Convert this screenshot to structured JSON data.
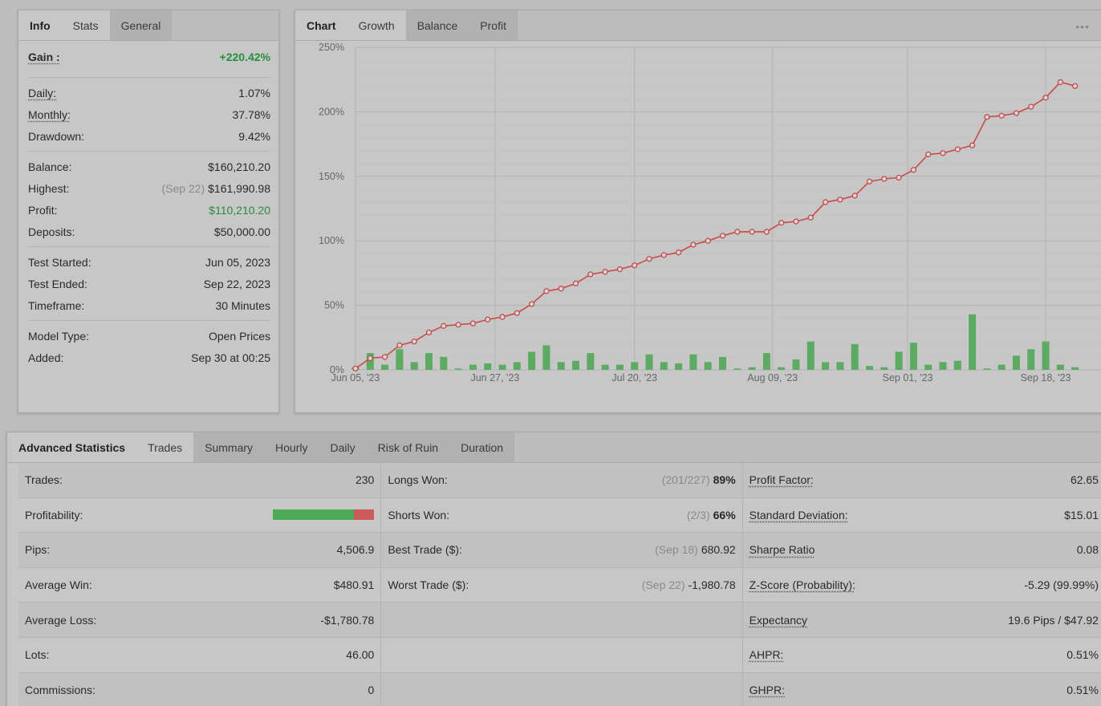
{
  "info_panel": {
    "tabs": [
      "Info",
      "Stats",
      "General"
    ],
    "gain": {
      "label": "Gain :",
      "value": "+220.42%"
    },
    "group1": [
      {
        "label": "Daily:",
        "value": "1.07%"
      },
      {
        "label": "Monthly:",
        "value": "37.78%"
      },
      {
        "label": "Drawdown:",
        "value": "9.42%"
      }
    ],
    "group2": [
      {
        "label": "Balance:",
        "value": "$160,210.20"
      },
      {
        "label": "Highest:",
        "note": "(Sep 22)",
        "value": "$161,990.98"
      },
      {
        "label": "Profit:",
        "value": "$110,210.20"
      },
      {
        "label": "Deposits:",
        "value": "$50,000.00"
      }
    ],
    "group3": [
      {
        "label": "Test Started:",
        "value": "Jun 05, 2023"
      },
      {
        "label": "Test Ended:",
        "value": "Sep 22, 2023"
      },
      {
        "label": "Timeframe:",
        "value": "30 Minutes"
      }
    ],
    "group4": [
      {
        "label": "Model Type:",
        "value": "Open Prices"
      },
      {
        "label": "Added:",
        "value": "Sep 30 at 00:25"
      }
    ],
    "colors": {
      "positive": "#23913a"
    }
  },
  "chart_panel": {
    "tabs": [
      "Chart",
      "Growth",
      "Balance",
      "Profit"
    ],
    "menu_icon": "more-dots-icon"
  },
  "chart_data": {
    "type": "line",
    "title": "",
    "xlabel": "",
    "ylabel": "",
    "ylim": [
      0,
      250
    ],
    "y_ticks": [
      "0%",
      "50%",
      "100%",
      "150%",
      "200%",
      "250%"
    ],
    "x_ticks": [
      "Jun 05, '23",
      "Jun 27, '23",
      "Jul 20, '23",
      "Aug 09, '23",
      "Sep 01, '23",
      "Sep 18, '23"
    ],
    "grid": true,
    "series": [
      {
        "type": "line",
        "color": "#c84a4a",
        "values": [
          1,
          9,
          10,
          19,
          22,
          29,
          34,
          35,
          36,
          39,
          41,
          44,
          51,
          61,
          63,
          67,
          74,
          76,
          78,
          81,
          86,
          89,
          91,
          97,
          100,
          104,
          107,
          107,
          107,
          114,
          115,
          118,
          130,
          132,
          135,
          146,
          148,
          149,
          155,
          167,
          168,
          171,
          174,
          196,
          197,
          199,
          204,
          211,
          223,
          220
        ]
      },
      {
        "type": "bar",
        "color": "#5daa62",
        "values": [
          2,
          13,
          4,
          16,
          6,
          13,
          10,
          1,
          4,
          5,
          4,
          6,
          14,
          19,
          6,
          7,
          13,
          4,
          4,
          6,
          12,
          6,
          5,
          12,
          6,
          10,
          1,
          2,
          13,
          2,
          8,
          22,
          6,
          6,
          20,
          3,
          2,
          14,
          21,
          4,
          6,
          7,
          43,
          1,
          4,
          11,
          16,
          22,
          4,
          2
        ]
      }
    ]
  },
  "advanced": {
    "tabs": [
      "Advanced Statistics",
      "Trades",
      "Summary",
      "Hourly",
      "Daily",
      "Risk of Ruin",
      "Duration"
    ],
    "col1": [
      {
        "label": "Trades:",
        "value": "230"
      },
      {
        "label": "Profitability:",
        "value": "",
        "bar": {
          "win_fraction": 0.8
        }
      },
      {
        "label": "Pips:",
        "value": "4,506.9"
      },
      {
        "label": "Average Win:",
        "value": "$480.91"
      },
      {
        "label": "Average Loss:",
        "value": "-$1,780.78"
      },
      {
        "label": "Lots:",
        "value": "46.00"
      },
      {
        "label": "Commissions:",
        "value": "0"
      }
    ],
    "col2": [
      {
        "label": "Longs Won:",
        "note": "(201/227)",
        "value": "89%"
      },
      {
        "label": "Shorts Won:",
        "note": "(2/3)",
        "value": "66%"
      },
      {
        "label": "Best Trade ($):",
        "note": "(Sep 18)",
        "value": "680.92"
      },
      {
        "label": "Worst Trade ($):",
        "note": "(Sep 22)",
        "value": "-1,980.78"
      },
      {
        "label": "",
        "note": "",
        "value": ""
      },
      {
        "label": "",
        "note": "",
        "value": ""
      },
      {
        "label": "",
        "note": "",
        "value": ""
      }
    ],
    "col3": [
      {
        "label": "Profit Factor:",
        "value": "62.65"
      },
      {
        "label": "Standard Deviation:",
        "value": "$15.01"
      },
      {
        "label": "Sharpe Ratio",
        "value": "0.08"
      },
      {
        "label": "Z-Score (Probability):",
        "value": "-5.29 (99.99%)"
      },
      {
        "label": "Expectancy",
        "value": "19.6 Pips / $47.92"
      },
      {
        "label": "AHPR:",
        "value": "0.51%"
      },
      {
        "label": "GHPR:",
        "value": "0.51%"
      }
    ],
    "colors": {
      "win": "#4caa55",
      "loss": "#cc5a5a"
    }
  }
}
